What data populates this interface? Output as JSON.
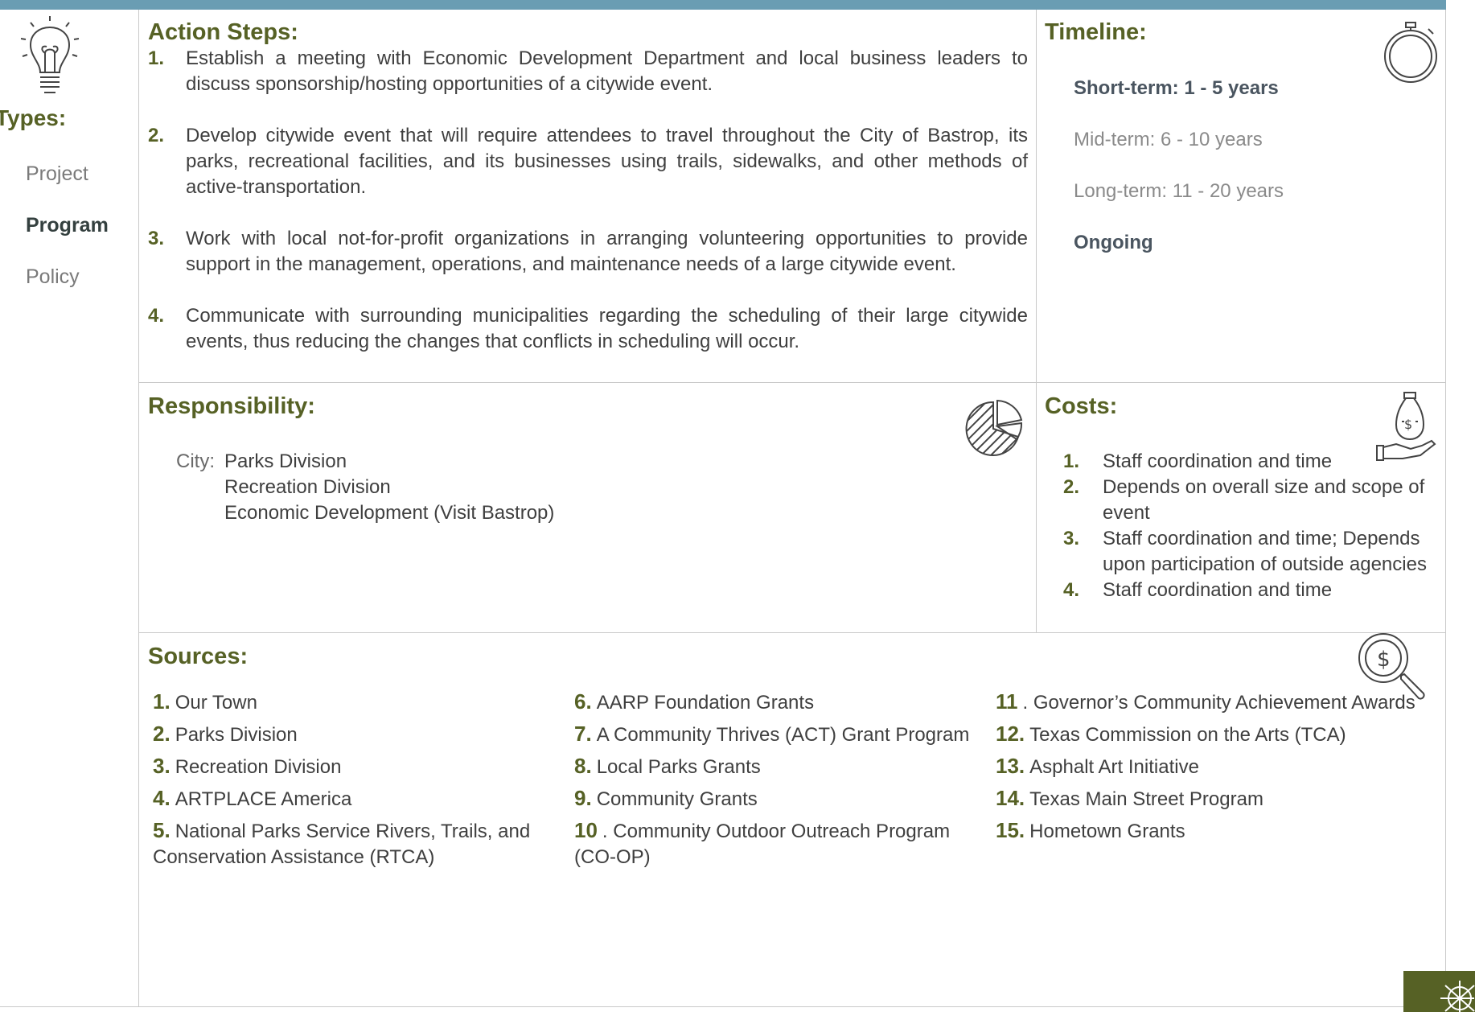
{
  "types": {
    "title": "Types:",
    "items": [
      {
        "label": "Project",
        "active": false
      },
      {
        "label": "Program",
        "active": true
      },
      {
        "label": "Policy",
        "active": false
      }
    ]
  },
  "action_steps": {
    "title": "Action Steps:",
    "items": [
      {
        "num": "1.",
        "text": "Establish a meeting with Economic Development Department and local business leaders to discuss sponsorship/hosting opportunities of a citywide event."
      },
      {
        "num": "2.",
        "text": "Develop citywide event that will require attendees to travel throughout the City of Bastrop, its parks, recreational facilities, and its businesses using trails, sidewalks, and other methods of active-transportation."
      },
      {
        "num": "3.",
        "text": "Work with local not-for-profit organizations in arranging volunteering opportunities to provide support in the management, operations, and maintenance needs of a large citywide event."
      },
      {
        "num": "4.",
        "text": "Communicate with surrounding municipalities regarding the scheduling of their large citywide events, thus reducing the changes that conflicts in scheduling will occur."
      }
    ]
  },
  "timeline": {
    "title": "Timeline:",
    "items": [
      {
        "label": "Short-term:  1 - 5 years",
        "selected": true
      },
      {
        "label": "Mid-term:  6 - 10 years",
        "selected": false
      },
      {
        "label": "Long-term:  11 - 20 years",
        "selected": false
      },
      {
        "label": "Ongoing",
        "selected": true
      }
    ]
  },
  "responsibility": {
    "title": "Responsibility:",
    "label": "City:",
    "lines": [
      "Parks Division",
      "Recreation Division",
      "Economic Development (Visit Bastrop)"
    ]
  },
  "costs": {
    "title": "Costs:",
    "items": [
      {
        "num": "1.",
        "text": "Staff coordination and time"
      },
      {
        "num": "2.",
        "text": "Depends on overall size and scope of event"
      },
      {
        "num": "3.",
        "text": "Staff coordination and time; Depends upon participation of outside agencies"
      },
      {
        "num": "4.",
        "text": "Staff coordination and time"
      }
    ]
  },
  "sources": {
    "title": "Sources:",
    "columns": [
      [
        {
          "num": "1.",
          "text": "Our Town"
        },
        {
          "num": "2.",
          "text": "Parks Division"
        },
        {
          "num": "3.",
          "text": "Recreation Division"
        },
        {
          "num": "4.",
          "text": "ARTPLACE America"
        },
        {
          "num": "5.",
          "text": "National Parks Service Rivers, Trails, and Conservation Assistance (RTCA)"
        }
      ],
      [
        {
          "num": "6.",
          "text": "AARP Foundation Grants"
        },
        {
          "num": "7.",
          "text": "A Community Thrives (ACT) Grant Program"
        },
        {
          "num": "8.",
          "text": "Local Parks Grants"
        },
        {
          "num": "9.",
          "text": "Community Grants"
        },
        {
          "num": "10",
          "text": ". Community Outdoor Outreach Program (CO-OP)"
        }
      ],
      [
        {
          "num": "11",
          "text": ". Governor’s Community Achievement Awards"
        },
        {
          "num": "12.",
          "text": "Texas Commission on the Arts (TCA)"
        },
        {
          "num": "13.",
          "text": "Asphalt Art Initiative"
        },
        {
          "num": "14.",
          "text": "Texas Main Street Program"
        },
        {
          "num": "15.",
          "text": "Hometown Grants"
        }
      ]
    ]
  },
  "colors": {
    "accent_green": "#566125",
    "top_bar": "#6a9db3",
    "divider": "#c9c9c9"
  },
  "icons": [
    "lightbulb-icon",
    "stopwatch-icon",
    "pie-chart-icon",
    "money-bag-hand-icon",
    "dollar-magnifier-icon",
    "city-logo-icon"
  ]
}
